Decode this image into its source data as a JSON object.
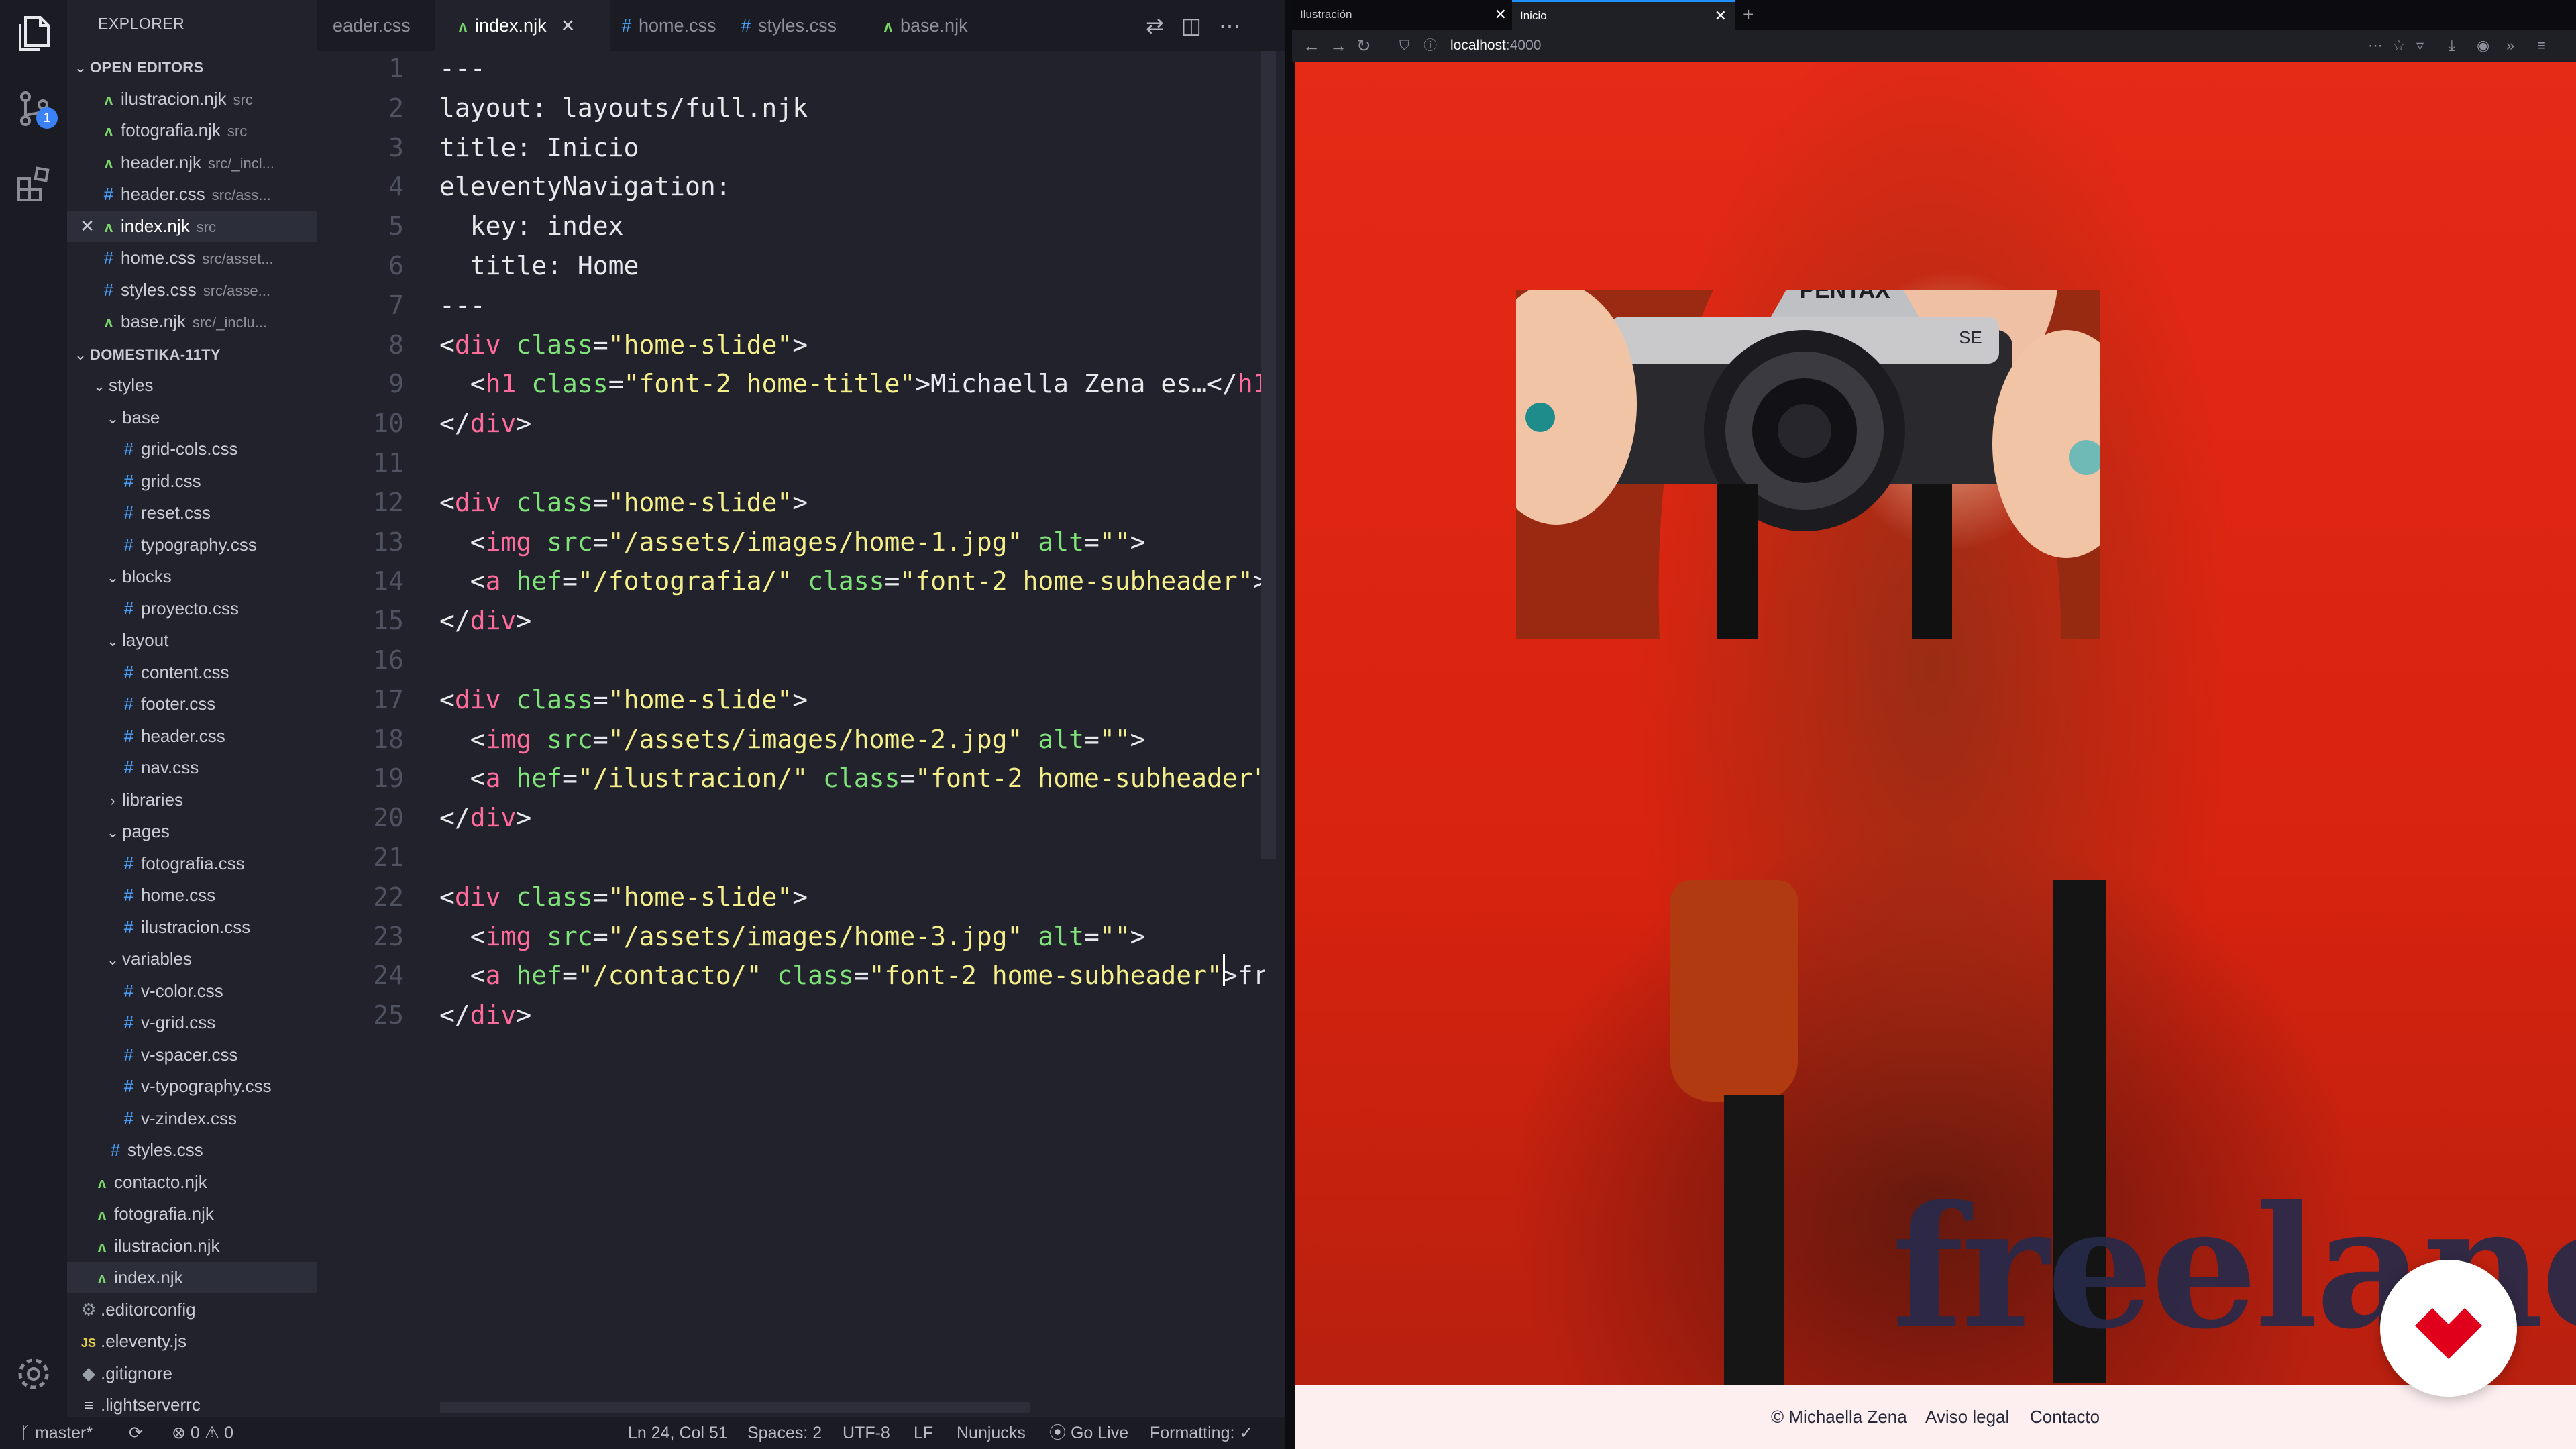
{
  "editor": {
    "explorer_title": "EXPLORER",
    "source_control_badge": "1",
    "tabs": [
      {
        "label": "eader.css",
        "icon": "css-file-icon"
      },
      {
        "label": "index.njk",
        "icon": "njk-file-icon",
        "active": true
      },
      {
        "label": "home.css",
        "icon": "css-file-icon"
      },
      {
        "label": "styles.css",
        "icon": "css-file-icon"
      },
      {
        "label": "base.njk",
        "icon": "njk-file-icon"
      }
    ],
    "open_editors": {
      "title": "OPEN EDITORS",
      "items": [
        {
          "name": "ilustracion.njk",
          "hint": "src",
          "type": "njk"
        },
        {
          "name": "fotografia.njk",
          "hint": "src",
          "type": "njk"
        },
        {
          "name": "header.njk",
          "hint": "src/_incl...",
          "type": "njk"
        },
        {
          "name": "header.css",
          "hint": "src/ass...",
          "type": "css"
        },
        {
          "name": "index.njk",
          "hint": "src",
          "type": "njk",
          "active": true
        },
        {
          "name": "home.css",
          "hint": "src/asset...",
          "type": "css"
        },
        {
          "name": "styles.css",
          "hint": "src/asse...",
          "type": "css"
        },
        {
          "name": "base.njk",
          "hint": "src/_inclu...",
          "type": "njk"
        }
      ]
    },
    "project": {
      "title": "DOMESTIKA-11TY",
      "tree": [
        {
          "name": "styles",
          "depth": 1,
          "kind": "folder",
          "open": true
        },
        {
          "name": "base",
          "depth": 2,
          "kind": "folder",
          "open": true
        },
        {
          "name": "grid-cols.css",
          "depth": 3,
          "kind": "css"
        },
        {
          "name": "grid.css",
          "depth": 3,
          "kind": "css"
        },
        {
          "name": "reset.css",
          "depth": 3,
          "kind": "css"
        },
        {
          "name": "typography.css",
          "depth": 3,
          "kind": "css"
        },
        {
          "name": "blocks",
          "depth": 2,
          "kind": "folder",
          "open": true
        },
        {
          "name": "proyecto.css",
          "depth": 3,
          "kind": "css"
        },
        {
          "name": "layout",
          "depth": 2,
          "kind": "folder",
          "open": true
        },
        {
          "name": "content.css",
          "depth": 3,
          "kind": "css"
        },
        {
          "name": "footer.css",
          "depth": 3,
          "kind": "css"
        },
        {
          "name": "header.css",
          "depth": 3,
          "kind": "css"
        },
        {
          "name": "nav.css",
          "depth": 3,
          "kind": "css"
        },
        {
          "name": "libraries",
          "depth": 2,
          "kind": "folder",
          "open": false
        },
        {
          "name": "pages",
          "depth": 2,
          "kind": "folder",
          "open": true
        },
        {
          "name": "fotografia.css",
          "depth": 3,
          "kind": "css"
        },
        {
          "name": "home.css",
          "depth": 3,
          "kind": "css"
        },
        {
          "name": "ilustracion.css",
          "depth": 3,
          "kind": "css"
        },
        {
          "name": "variables",
          "depth": 2,
          "kind": "folder",
          "open": true
        },
        {
          "name": "v-color.css",
          "depth": 3,
          "kind": "css"
        },
        {
          "name": "v-grid.css",
          "depth": 3,
          "kind": "css"
        },
        {
          "name": "v-spacer.css",
          "depth": 3,
          "kind": "css"
        },
        {
          "name": "v-typography.css",
          "depth": 3,
          "kind": "css"
        },
        {
          "name": "v-zindex.css",
          "depth": 3,
          "kind": "css"
        },
        {
          "name": "styles.css",
          "depth": 2,
          "kind": "css"
        },
        {
          "name": "contacto.njk",
          "depth": 1,
          "kind": "njk"
        },
        {
          "name": "fotografia.njk",
          "depth": 1,
          "kind": "njk"
        },
        {
          "name": "ilustracion.njk",
          "depth": 1,
          "kind": "njk"
        },
        {
          "name": "index.njk",
          "depth": 1,
          "kind": "njk",
          "selected": true
        },
        {
          "name": ".editorconfig",
          "depth": 0,
          "kind": "gear"
        },
        {
          "name": ".eleventy.js",
          "depth": 0,
          "kind": "js"
        },
        {
          "name": ".gitignore",
          "depth": 0,
          "kind": "dot"
        },
        {
          "name": ".lightserverrc",
          "depth": 0,
          "kind": "lines"
        }
      ]
    },
    "code_lines": [
      [
        [
          "---",
          "plain"
        ]
      ],
      [
        [
          "layout: layouts/full.njk",
          "plain"
        ]
      ],
      [
        [
          "title: Inicio",
          "plain"
        ]
      ],
      [
        [
          "eleventyNavigation:",
          "plain"
        ]
      ],
      [
        [
          "  key: index",
          "plain"
        ]
      ],
      [
        [
          "  title: Home",
          "plain"
        ]
      ],
      [
        [
          "---",
          "plain"
        ]
      ],
      [
        [
          "<",
          "plain"
        ],
        [
          "div",
          "tag"
        ],
        [
          " ",
          "plain"
        ],
        [
          "class",
          "attr"
        ],
        [
          "=",
          "plain"
        ],
        [
          "\"home-slide\"",
          "str"
        ],
        [
          ">",
          "plain"
        ]
      ],
      [
        [
          "  <",
          "plain"
        ],
        [
          "h1",
          "tag"
        ],
        [
          " ",
          "plain"
        ],
        [
          "class",
          "attr"
        ],
        [
          "=",
          "plain"
        ],
        [
          "\"font-2 home-title\"",
          "str"
        ],
        [
          ">Michaella Zena es…</",
          "plain"
        ],
        [
          "h1",
          "tag"
        ]
      ],
      [
        [
          "</",
          "plain"
        ],
        [
          "div",
          "tag"
        ],
        [
          ">",
          "plain"
        ]
      ],
      [],
      [
        [
          "<",
          "plain"
        ],
        [
          "div",
          "tag"
        ],
        [
          " ",
          "plain"
        ],
        [
          "class",
          "attr"
        ],
        [
          "=",
          "plain"
        ],
        [
          "\"home-slide\"",
          "str"
        ],
        [
          ">",
          "plain"
        ]
      ],
      [
        [
          "  <",
          "plain"
        ],
        [
          "img",
          "tag"
        ],
        [
          " ",
          "plain"
        ],
        [
          "src",
          "attr"
        ],
        [
          "=",
          "plain"
        ],
        [
          "\"/assets/images/home-1.jpg\"",
          "str"
        ],
        [
          " ",
          "plain"
        ],
        [
          "alt",
          "attr"
        ],
        [
          "=",
          "plain"
        ],
        [
          "\"\"",
          "str"
        ],
        [
          ">",
          "plain"
        ]
      ],
      [
        [
          "  <",
          "plain"
        ],
        [
          "a",
          "tag"
        ],
        [
          " ",
          "plain"
        ],
        [
          "hef",
          "attr"
        ],
        [
          "=",
          "plain"
        ],
        [
          "\"/fotografia/\"",
          "str"
        ],
        [
          " ",
          "plain"
        ],
        [
          "class",
          "attr"
        ],
        [
          "=",
          "plain"
        ],
        [
          "\"font-2 home-subheader\"",
          "str"
        ],
        [
          ">",
          "plain"
        ]
      ],
      [
        [
          "</",
          "plain"
        ],
        [
          "div",
          "tag"
        ],
        [
          ">",
          "plain"
        ]
      ],
      [],
      [
        [
          "<",
          "plain"
        ],
        [
          "div",
          "tag"
        ],
        [
          " ",
          "plain"
        ],
        [
          "class",
          "attr"
        ],
        [
          "=",
          "plain"
        ],
        [
          "\"home-slide\"",
          "str"
        ],
        [
          ">",
          "plain"
        ]
      ],
      [
        [
          "  <",
          "plain"
        ],
        [
          "img",
          "tag"
        ],
        [
          " ",
          "plain"
        ],
        [
          "src",
          "attr"
        ],
        [
          "=",
          "plain"
        ],
        [
          "\"/assets/images/home-2.jpg\"",
          "str"
        ],
        [
          " ",
          "plain"
        ],
        [
          "alt",
          "attr"
        ],
        [
          "=",
          "plain"
        ],
        [
          "\"\"",
          "str"
        ],
        [
          ">",
          "plain"
        ]
      ],
      [
        [
          "  <",
          "plain"
        ],
        [
          "a",
          "tag"
        ],
        [
          " ",
          "plain"
        ],
        [
          "hef",
          "attr"
        ],
        [
          "=",
          "plain"
        ],
        [
          "\"/ilustracion/\"",
          "str"
        ],
        [
          " ",
          "plain"
        ],
        [
          "class",
          "attr"
        ],
        [
          "=",
          "plain"
        ],
        [
          "\"font-2 home-subheader\"",
          "str"
        ]
      ],
      [
        [
          "</",
          "plain"
        ],
        [
          "div",
          "tag"
        ],
        [
          ">",
          "plain"
        ]
      ],
      [],
      [
        [
          "<",
          "plain"
        ],
        [
          "div",
          "tag"
        ],
        [
          " ",
          "plain"
        ],
        [
          "class",
          "attr"
        ],
        [
          "=",
          "plain"
        ],
        [
          "\"home-slide\"",
          "str"
        ],
        [
          ">",
          "plain"
        ]
      ],
      [
        [
          "  <",
          "plain"
        ],
        [
          "img",
          "tag"
        ],
        [
          " ",
          "plain"
        ],
        [
          "src",
          "attr"
        ],
        [
          "=",
          "plain"
        ],
        [
          "\"/assets/images/home-3.jpg\"",
          "str"
        ],
        [
          " ",
          "plain"
        ],
        [
          "alt",
          "attr"
        ],
        [
          "=",
          "plain"
        ],
        [
          "\"\"",
          "str"
        ],
        [
          ">",
          "plain"
        ]
      ],
      [
        [
          "  <",
          "plain"
        ],
        [
          "a",
          "tag"
        ],
        [
          " ",
          "plain"
        ],
        [
          "hef",
          "attr"
        ],
        [
          "=",
          "plain"
        ],
        [
          "\"/contacto/\"",
          "str"
        ],
        [
          " ",
          "plain"
        ],
        [
          "class",
          "attr"
        ],
        [
          "=",
          "plain"
        ],
        [
          "\"font-2 home-subheader\"",
          "str"
        ],
        [
          ">fr",
          "plain"
        ]
      ],
      [
        [
          "</",
          "plain"
        ],
        [
          "div",
          "tag"
        ],
        [
          ">",
          "plain"
        ]
      ]
    ],
    "status": {
      "branch": "master*",
      "sync": "⟳",
      "problems": "⊗ 0 ⚠ 0",
      "position": "Ln 24, Col 51",
      "spaces": "Spaces: 2",
      "encoding": "UTF-8",
      "eol": "LF",
      "language": "Nunjucks",
      "golive": "Go Live",
      "formatting": "Formatting: ✓"
    }
  },
  "browser": {
    "tabs": [
      {
        "label": "Ilustración",
        "active": false
      },
      {
        "label": "Inicio",
        "active": true
      }
    ],
    "url_host": "localhost",
    "url_port": ":4000",
    "hero_text": "freelance",
    "footer_links": [
      "© Michaella Zena",
      "Aviso legal",
      "Contacto"
    ]
  },
  "colors": {
    "accent": "#1e90ff",
    "hero_red": "#e52a16",
    "logo_red": "#e0001b",
    "footer_bg": "#fdeff0"
  }
}
